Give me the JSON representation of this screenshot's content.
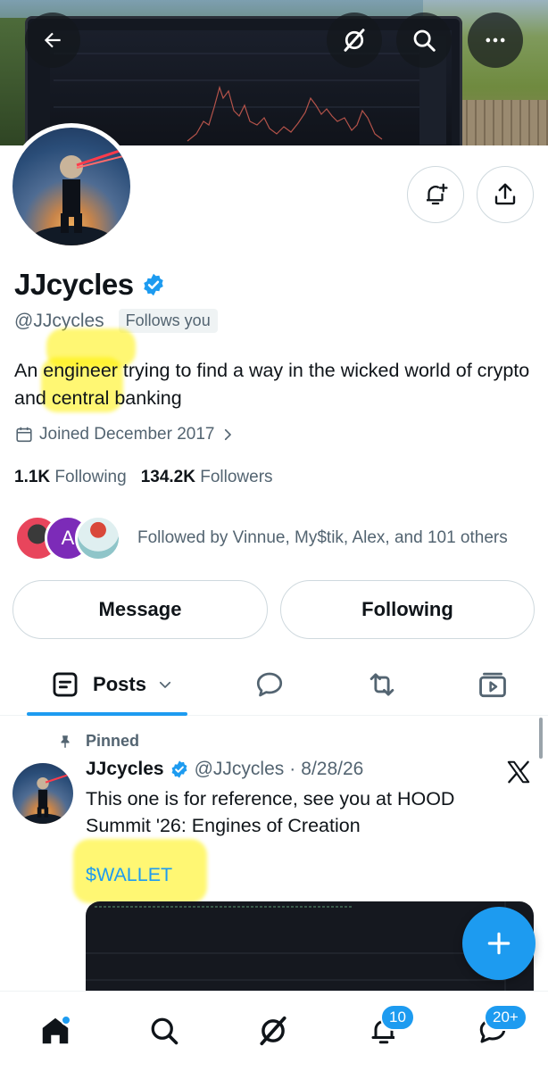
{
  "header": {
    "back_icon": "arrow-left-icon",
    "grok_icon": "grok-icon",
    "search_icon": "search-icon",
    "more_icon": "more-icon"
  },
  "profile": {
    "display_name": "JJcycles",
    "verified": true,
    "handle": "@JJcycles",
    "follows_you": "Follows you",
    "bio": "An engineer trying to find a way in the wicked world of crypto and central banking",
    "joined": "Joined December 2017",
    "following_count": "1.1K",
    "following_label": "Following",
    "followers_count": "134.2K",
    "followers_label": "Followers",
    "followed_by": "Followed by Vinnue, My$tik, Alex, and 101 others",
    "follower_avatar_letter": "A"
  },
  "actions": {
    "message_label": "Message",
    "following_label": "Following"
  },
  "tabs": {
    "posts_label": "Posts",
    "items": [
      "posts",
      "replies",
      "reposts",
      "media"
    ]
  },
  "pinned_post": {
    "pinned_label": "Pinned",
    "author_name": "JJcycles",
    "author_handle": "@JJcycles",
    "separator": "·",
    "date": "8/28/26",
    "text": "This one is for reference, see you at HOOD Summit '26: Engines of Creation",
    "cashtag": "$WALLET"
  },
  "bottom_nav": {
    "notifications_badge": "10",
    "messages_badge": "20+"
  },
  "colors": {
    "accent": "#1d9bf0",
    "text_primary": "#0f1419",
    "text_secondary": "#536471",
    "highlight": "#fff200"
  }
}
